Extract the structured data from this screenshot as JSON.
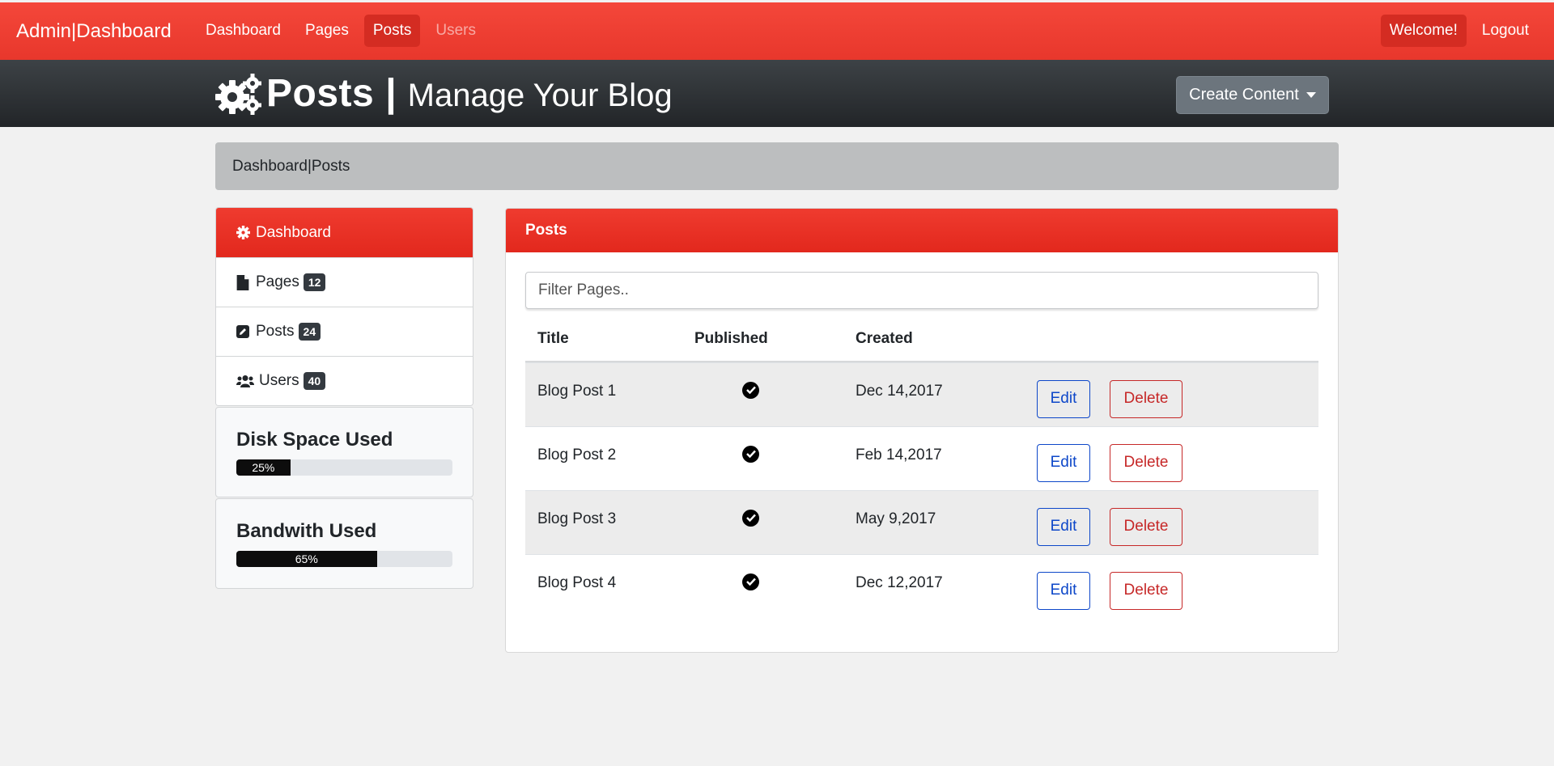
{
  "navbar": {
    "brand": "Admin|Dashboard",
    "links": [
      "Dashboard",
      "Pages",
      "Posts",
      "Users"
    ],
    "active": "Posts",
    "disabled": "Users",
    "right": [
      "Welcome!",
      "Logout"
    ]
  },
  "header": {
    "icon": "gears-icon",
    "title": "Posts",
    "separator": "|",
    "subtitle": "Manage Your Blog",
    "create_button": "Create Content"
  },
  "breadcrumb": "Dashboard|Posts",
  "sidebar": {
    "items": [
      {
        "icon": "gear-icon",
        "label": "Dashboard",
        "badge": ""
      },
      {
        "icon": "file-icon",
        "label": "Pages",
        "badge": "12"
      },
      {
        "icon": "pencil-square-icon",
        "label": "Posts",
        "badge": "24"
      },
      {
        "icon": "users-icon",
        "label": "Users",
        "badge": "40"
      }
    ],
    "disk": {
      "title": "Disk Space Used",
      "label": "25%",
      "value": 0.25
    },
    "bandwidth": {
      "title": "Bandwith Used",
      "label": "65%",
      "value": 0.65
    }
  },
  "panel": {
    "heading": "Posts",
    "filter_placeholder": "Filter Pages..",
    "columns": [
      "Title",
      "Published",
      "Created"
    ],
    "rows": [
      {
        "title": "Blog Post 1",
        "published": true,
        "created": "Dec 14,2017"
      },
      {
        "title": "Blog Post 2",
        "published": true,
        "created": "Feb 14,2017"
      },
      {
        "title": "Blog Post 3",
        "published": true,
        "created": "May 9,2017"
      },
      {
        "title": "Blog Post 4",
        "published": true,
        "created": "Dec 12,2017"
      }
    ],
    "edit_label": "Edit",
    "delete_label": "Delete"
  },
  "colors": {
    "accent": "#e8372c",
    "dark": "#2b2f33",
    "edit": "#0d47c9",
    "delete": "#c62828"
  }
}
